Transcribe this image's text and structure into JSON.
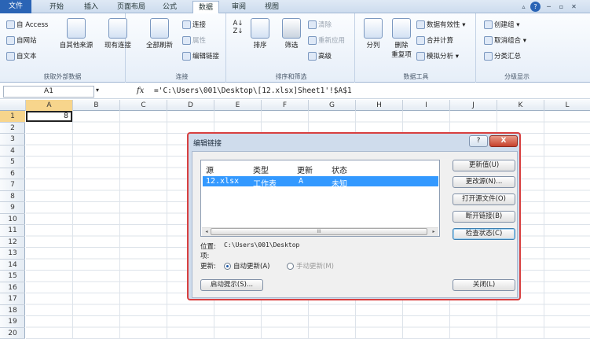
{
  "tabs": [
    "文件",
    "开始",
    "插入",
    "页面布局",
    "公式",
    "数据",
    "审阅",
    "视图"
  ],
  "active_tab": "数据",
  "ribbon": {
    "external": {
      "access": "自 Access",
      "web": "自网站",
      "text": "自文本",
      "other": "自其他来源",
      "existing": "现有连接",
      "label": "获取外部数据"
    },
    "connections": {
      "refresh_all": "全部刷新",
      "connections": "连接",
      "properties": "属性",
      "edit_links": "编辑链接",
      "label": "连接"
    },
    "sort": {
      "sort": "排序",
      "filter": "筛选",
      "clear": "清除",
      "reapply": "重新应用",
      "advanced": "高级",
      "label": "排序和筛选"
    },
    "tools": {
      "text_to_columns": "分列",
      "remove_duplicates_1": "删除",
      "remove_duplicates_2": "重复项",
      "validation": "数据有效性",
      "consolidate": "合并计算",
      "what_if": "模拟分析",
      "label": "数据工具"
    },
    "outline": {
      "group": "创建组",
      "ungroup": "取消组合",
      "subtotal": "分类汇总",
      "label": "分级显示"
    }
  },
  "formula_bar": {
    "name_box": "A1",
    "fx": "fx",
    "formula": "='C:\\Users\\001\\Desktop\\[12.xlsx]Sheet1'!$A$1"
  },
  "columns": [
    "A",
    "B",
    "C",
    "D",
    "E",
    "F",
    "G",
    "H",
    "I",
    "J",
    "K",
    "L"
  ],
  "rows": [
    "1",
    "2",
    "3",
    "4",
    "5",
    "6",
    "7",
    "8",
    "9",
    "10",
    "11",
    "12",
    "13",
    "14",
    "15",
    "16",
    "17",
    "18",
    "19",
    "20"
  ],
  "cell_a1": "8",
  "dialog": {
    "title": "编辑链接",
    "help": "?",
    "close": "X",
    "headers": {
      "source": "源",
      "type": "类型",
      "update": "更新",
      "status": "状态"
    },
    "row": {
      "source": "12.xlsx",
      "type": "工作表",
      "update": "A",
      "status": "未知"
    },
    "scroll_thumb": "III",
    "location_label": "位置:",
    "location_value": "C:\\Users\\001\\Desktop",
    "item_label": "项:",
    "update_label": "更新:",
    "auto_update": "自动更新(A)",
    "manual_update": "手动更新(M)",
    "buttons": {
      "update_values": "更新值(U)",
      "change_source": "更改源(N)...",
      "open_source": "打开源文件(O)",
      "break_link": "断开链接(B)",
      "check_status": "检查状态(C)",
      "startup_prompt": "启动提示(S)...",
      "close": "关闭(L)"
    }
  },
  "colors": {
    "file_tab": "#2a64b5",
    "selection": "#3399ff",
    "dialog_border": "#d84040"
  }
}
